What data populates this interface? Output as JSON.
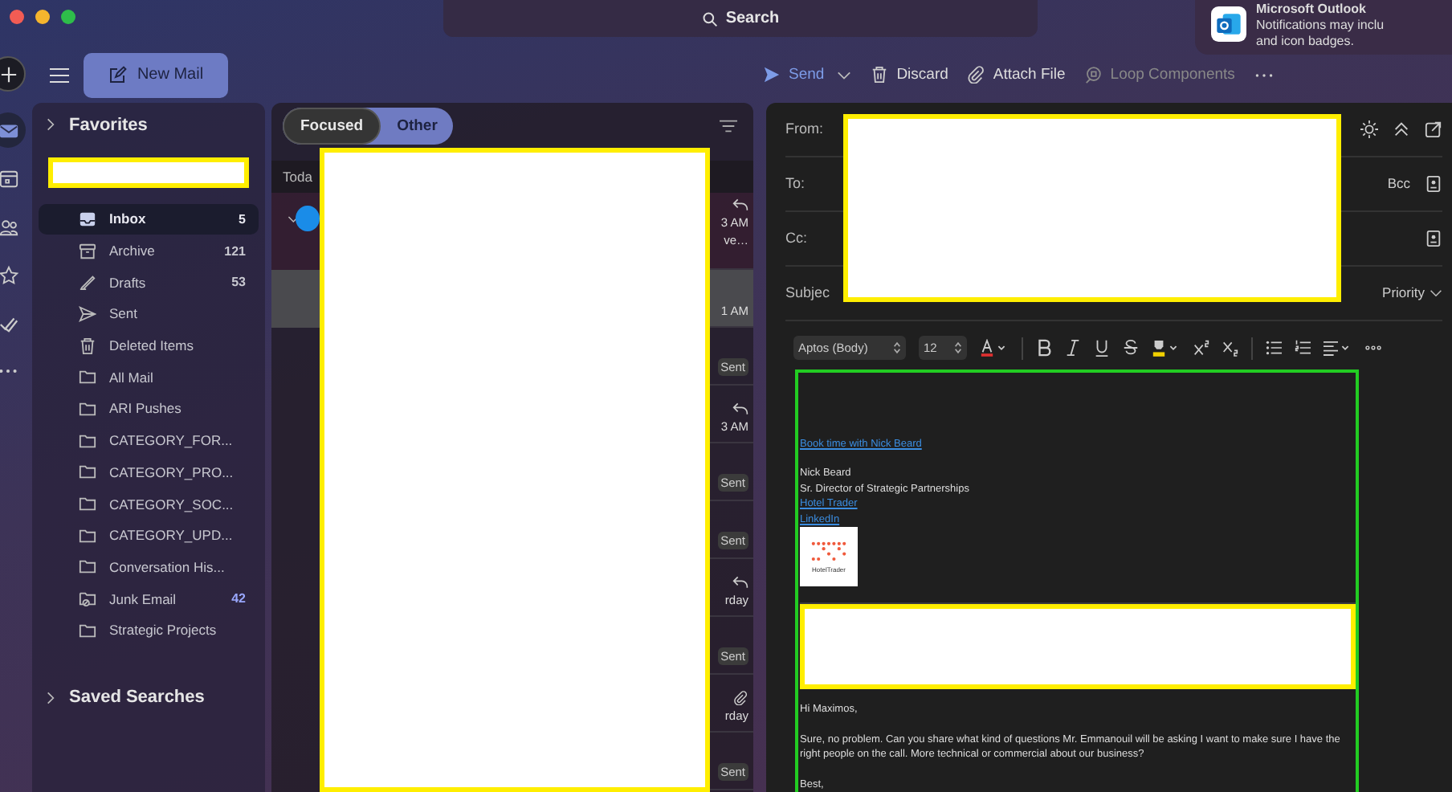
{
  "window": {
    "search": "Search"
  },
  "notification": {
    "title": "Microsoft Outlook",
    "lines": [
      "Notifications may inclu",
      "and icon badges."
    ]
  },
  "rail": [
    {
      "kind": "mail",
      "selected": true
    },
    {
      "kind": "calendar",
      "selected": false
    },
    {
      "kind": "people",
      "selected": false
    },
    {
      "kind": "star",
      "selected": false
    },
    {
      "kind": "tasks",
      "selected": false
    },
    {
      "kind": "more",
      "selected": false
    }
  ],
  "toolbar": {
    "new_mail": "New Mail",
    "actions": [
      {
        "kind": "send",
        "label": "Send",
        "disabled": false
      },
      {
        "kind": "discard",
        "label": "Discard",
        "disabled": false
      },
      {
        "kind": "attach",
        "label": "Attach File",
        "disabled": false
      },
      {
        "kind": "loop",
        "label": "Loop Components",
        "disabled": true
      }
    ]
  },
  "folders": {
    "favorites": "Favorites",
    "saved_searches": "Saved Searches",
    "items": [
      {
        "kind": "inbox",
        "label": "Inbox",
        "count": "5",
        "selected": true
      },
      {
        "kind": "archive",
        "label": "Archive",
        "count": "121",
        "selected": false
      },
      {
        "kind": "drafts",
        "label": "Drafts",
        "count": "53",
        "selected": false
      },
      {
        "kind": "sent",
        "label": "Sent",
        "selected": false
      },
      {
        "kind": "trash",
        "label": "Deleted Items",
        "selected": false
      },
      {
        "kind": "folder",
        "label": "All Mail",
        "selected": false
      },
      {
        "kind": "folder",
        "label": "ARI Pushes",
        "selected": false
      },
      {
        "kind": "folder",
        "label": "CATEGORY_FOR...",
        "selected": false
      },
      {
        "kind": "folder",
        "label": "CATEGORY_PRO...",
        "selected": false
      },
      {
        "kind": "folder",
        "label": "CATEGORY_SOC...",
        "selected": false
      },
      {
        "kind": "folder",
        "label": "CATEGORY_UPD...",
        "selected": false
      },
      {
        "kind": "folder",
        "label": "Conversation His...",
        "selected": false
      },
      {
        "kind": "junk",
        "label": "Junk Email",
        "count": "42",
        "selected": false
      },
      {
        "kind": "folder",
        "label": "Strategic Projects",
        "selected": false
      }
    ]
  },
  "message_list": {
    "tabs": [
      {
        "label": "Focused",
        "selected": true
      },
      {
        "label": "Other",
        "selected": false
      }
    ],
    "group": "Toda",
    "rows": [
      {
        "kind": "reply",
        "time": "3 AM",
        "preview": "ve…",
        "selected": false
      },
      {
        "time": "1 AM",
        "selected": true
      },
      {
        "tag": "Sent",
        "selected": false
      },
      {
        "kind": "reply",
        "time": "3 AM",
        "selected": false
      },
      {
        "tag": "Sent",
        "selected": false
      },
      {
        "tag": "Sent",
        "selected": false
      },
      {
        "kind": "reply",
        "time": "rday",
        "selected": false
      },
      {
        "tag": "Sent",
        "selected": false
      },
      {
        "kind": "attachment",
        "time": "rday",
        "selected": false
      },
      {
        "tag": "Sent",
        "selected": false
      }
    ]
  },
  "compose": {
    "fields": [
      {
        "label": "From:",
        "kind": "from"
      },
      {
        "label": "To:",
        "kind": "to",
        "action": "Bcc"
      },
      {
        "label": "Cc:",
        "kind": "cc"
      },
      {
        "label": "Subjec",
        "kind": "subject",
        "action": "Priority"
      }
    ],
    "format": {
      "font": "Aptos (Body)",
      "size": "12"
    },
    "body": {
      "booking_link": "Book time with Nick Beard",
      "signature": [
        "Nick Beard",
        "Sr. Director of Strategic Partnerships"
      ],
      "links": [
        "Hotel Trader",
        "LinkedIn"
      ],
      "logo_text": "HotelTrader",
      "greeting": "Hi Maximos,",
      "paragraph": "Sure, no problem. Can you share what kind of questions Mr. Emmanouil will be asking I want to make sure I have the right people on the call. More technical or commercial about our business?",
      "closing": "Best,"
    }
  }
}
